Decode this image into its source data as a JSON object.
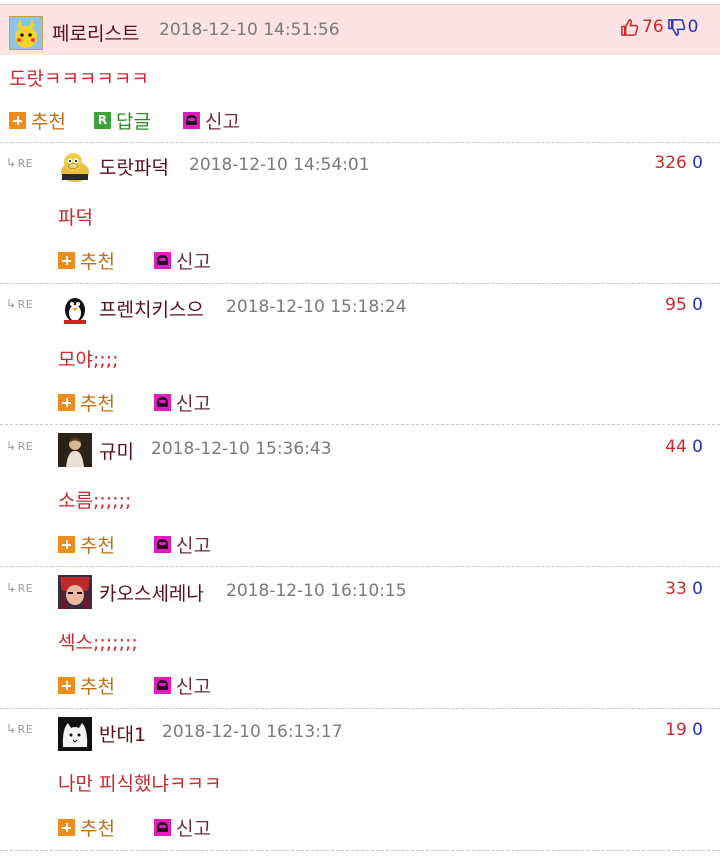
{
  "post": {
    "nickname": "페로리스트",
    "date": "2018-12-10 14:51:56",
    "up_votes": "76",
    "down_votes": "0",
    "body": "도랏ㅋㅋㅋㅋㅋㅋ",
    "actions": {
      "recommend": "추천",
      "reply": "답글",
      "report": "신고"
    }
  },
  "re_label": "RE",
  "comments": [
    {
      "nickname": "도랏파덕",
      "date": "2018-12-10 14:54:01",
      "up": "326",
      "down": "0",
      "body": "파덕",
      "recommend": "추천",
      "report": "신고"
    },
    {
      "nickname": "프렌치키스으",
      "date": "2018-12-10 15:18:24",
      "up": "95",
      "down": "0",
      "body": "모야;;;;",
      "recommend": "추천",
      "report": "신고"
    },
    {
      "nickname": "규미",
      "date": "2018-12-10 15:36:43",
      "up": "44",
      "down": "0",
      "body": "소름;;;;;;",
      "recommend": "추천",
      "report": "신고"
    },
    {
      "nickname": "카오스세레나",
      "date": "2018-12-10 16:10:15",
      "up": "33",
      "down": "0",
      "body": "섹스;;;;;;;",
      "recommend": "추천",
      "report": "신고"
    },
    {
      "nickname": "반대1",
      "date": "2018-12-10 16:13:17",
      "up": "19",
      "down": "0",
      "body": "나만 피식했냐ㅋㅋㅋ",
      "recommend": "추천",
      "report": "신고"
    }
  ],
  "colors": {
    "header_bg": "#fde3e3",
    "nickname": "#5a0f1a",
    "body_text": "#c8282e",
    "up_vote": "#c8282e",
    "down_vote": "#2830b4",
    "recommend": "#c07018",
    "reply": "#2d8a2a"
  }
}
